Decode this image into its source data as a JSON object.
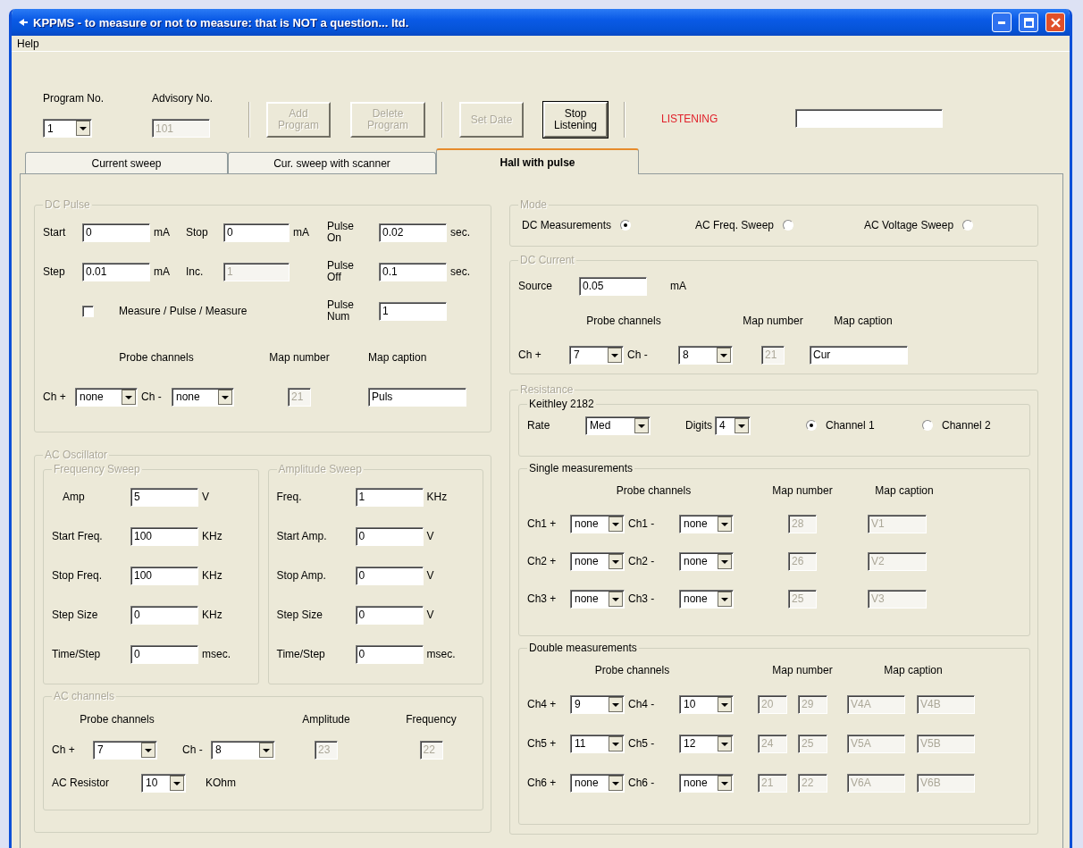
{
  "window": {
    "title": "KPPMS - to measure or not to measure: that is NOT a question...  ltd."
  },
  "menu": [
    {
      "label": "Help"
    }
  ],
  "toolbar": {
    "program_label": "Program No.",
    "program_value": "1",
    "advisory_label": "Advisory No.",
    "advisory_value": "101",
    "advisory_disabled": true,
    "buttons": [
      {
        "label": "Add Program",
        "disabled": true
      },
      {
        "label": "Delete Program",
        "disabled": true
      },
      {
        "label": "Set Date",
        "disabled": true
      },
      {
        "label": "Stop Listening",
        "disabled": false
      }
    ],
    "status": "LISTENING"
  },
  "tabs": [
    {
      "label": "Current sweep",
      "selected": false
    },
    {
      "label": "Cur. sweep with scanner",
      "selected": false
    },
    {
      "label": "Hall with pulse",
      "selected": true
    }
  ],
  "dc_pulse": {
    "title": "DC Pulse",
    "disabled": true,
    "items": [
      {
        "kind": "label",
        "text": "Start"
      },
      {
        "kind": "input",
        "value": "0",
        "disabled": false
      },
      {
        "kind": "label",
        "text": "mA"
      },
      {
        "kind": "label",
        "text": "Stop"
      },
      {
        "kind": "input",
        "value": "0",
        "disabled": false
      },
      {
        "kind": "label",
        "text": "mA"
      },
      {
        "kind": "label",
        "text": "Pulse On"
      },
      {
        "kind": "input",
        "value": "0.02",
        "disabled": false
      },
      {
        "kind": "label",
        "text": "sec."
      },
      {
        "kind": "label",
        "text": "Step"
      },
      {
        "kind": "input",
        "value": "0.01",
        "disabled": false
      },
      {
        "kind": "label",
        "text": "mA"
      },
      {
        "kind": "label",
        "text": "Inc."
      },
      {
        "kind": "input",
        "value": "1",
        "disabled": true
      },
      {
        "kind": "label",
        "text": "Pulse Off"
      },
      {
        "kind": "input",
        "value": "0.1",
        "disabled": false
      },
      {
        "kind": "label",
        "text": "sec."
      },
      {
        "kind": "check",
        "label": "Measure / Pulse / Measure",
        "checked": false
      },
      {
        "kind": "label",
        "text": "Pulse Num"
      },
      {
        "kind": "input",
        "value": "1",
        "disabled": false
      },
      {
        "kind": "label",
        "text": "Probe channels"
      },
      {
        "kind": "label",
        "text": "Map number"
      },
      {
        "kind": "label",
        "text": "Map caption"
      },
      {
        "kind": "label",
        "text": "Ch +"
      },
      {
        "kind": "combo",
        "value": "none"
      },
      {
        "kind": "label",
        "text": "Ch -"
      },
      {
        "kind": "combo",
        "value": "none"
      },
      {
        "kind": "input",
        "value": "21",
        "disabled": true
      },
      {
        "kind": "input",
        "value": "Puls",
        "disabled": false
      }
    ]
  },
  "ac_oscillator": {
    "title": "AC Oscillator",
    "disabled": true,
    "frequency_sweep": {
      "title": "Frequency Sweep",
      "disabled": true,
      "items": [
        {
          "kind": "label",
          "text": "Amp"
        },
        {
          "kind": "input",
          "value": "5",
          "disabled": false
        },
        {
          "kind": "label",
          "text": "V"
        },
        {
          "kind": "label",
          "text": "Start Freq."
        },
        {
          "kind": "input",
          "value": "100",
          "disabled": false
        },
        {
          "kind": "label",
          "text": "KHz"
        },
        {
          "kind": "label",
          "text": "Stop Freq."
        },
        {
          "kind": "input",
          "value": "100",
          "disabled": false
        },
        {
          "kind": "label",
          "text": "KHz"
        },
        {
          "kind": "label",
          "text": "Step Size"
        },
        {
          "kind": "input",
          "value": "0",
          "disabled": false
        },
        {
          "kind": "label",
          "text": "KHz"
        },
        {
          "kind": "label",
          "text": "Time/Step"
        },
        {
          "kind": "input",
          "value": "0",
          "disabled": false
        },
        {
          "kind": "label",
          "text": "msec."
        }
      ]
    },
    "amplitude_sweep": {
      "title": "Amplitude Sweep",
      "disabled": true,
      "items": [
        {
          "kind": "label",
          "text": "Freq."
        },
        {
          "kind": "input",
          "value": "1",
          "disabled": false
        },
        {
          "kind": "label",
          "text": "KHz"
        },
        {
          "kind": "label",
          "text": "Start Amp."
        },
        {
          "kind": "input",
          "value": "0",
          "disabled": false
        },
        {
          "kind": "label",
          "text": "V"
        },
        {
          "kind": "label",
          "text": "Stop Amp."
        },
        {
          "kind": "input",
          "value": "0",
          "disabled": false
        },
        {
          "kind": "label",
          "text": "V"
        },
        {
          "kind": "label",
          "text": "Step Size"
        },
        {
          "kind": "input",
          "value": "0",
          "disabled": false
        },
        {
          "kind": "label",
          "text": "V"
        },
        {
          "kind": "label",
          "text": "Time/Step"
        },
        {
          "kind": "input",
          "value": "0",
          "disabled": false
        },
        {
          "kind": "label",
          "text": "msec."
        }
      ]
    },
    "ac_channels": {
      "title": "AC channels",
      "disabled": true,
      "items": [
        {
          "kind": "label",
          "text": "Probe channels"
        },
        {
          "kind": "label",
          "text": "Amplitude"
        },
        {
          "kind": "label",
          "text": "Frequency"
        },
        {
          "kind": "label",
          "text": "Ch +"
        },
        {
          "kind": "combo",
          "value": "7"
        },
        {
          "kind": "label",
          "text": "Ch -"
        },
        {
          "kind": "combo",
          "value": "8"
        },
        {
          "kind": "input",
          "value": "23",
          "disabled": true
        },
        {
          "kind": "input",
          "value": "22",
          "disabled": true
        },
        {
          "kind": "label",
          "text": "AC Resistor"
        },
        {
          "kind": "combo",
          "value": "10"
        },
        {
          "kind": "label",
          "text": "KOhm"
        }
      ]
    }
  },
  "mode": {
    "title": "Mode",
    "disabled": true,
    "items": [
      {
        "kind": "radio",
        "label": "DC Measurements",
        "selected": true
      },
      {
        "kind": "radio",
        "label": "AC Freq. Sweep",
        "selected": false
      },
      {
        "kind": "radio",
        "label": "AC Voltage Sweep",
        "selected": false
      }
    ]
  },
  "dc_current": {
    "title": "DC Current",
    "disabled": true,
    "items": [
      {
        "kind": "label",
        "text": "Source"
      },
      {
        "kind": "input",
        "value": "0.05",
        "disabled": false
      },
      {
        "kind": "label",
        "text": "mA"
      },
      {
        "kind": "label",
        "text": "Probe channels"
      },
      {
        "kind": "label",
        "text": "Map number"
      },
      {
        "kind": "label",
        "text": "Map caption"
      },
      {
        "kind": "label",
        "text": "Ch +"
      },
      {
        "kind": "combo",
        "value": "7"
      },
      {
        "kind": "label",
        "text": "Ch -"
      },
      {
        "kind": "combo",
        "value": "8"
      },
      {
        "kind": "input",
        "value": "21",
        "disabled": true
      },
      {
        "kind": "input",
        "value": "Cur",
        "disabled": false
      }
    ]
  },
  "resistance": {
    "title": "Resistance",
    "disabled": true,
    "keithley": {
      "title": "Keithley 2182",
      "disabled": false,
      "items": [
        {
          "kind": "label",
          "text": "Rate"
        },
        {
          "kind": "combo",
          "value": "Med"
        },
        {
          "kind": "label",
          "text": "Digits"
        },
        {
          "kind": "combo",
          "value": "4"
        },
        {
          "kind": "radio",
          "label": "Channel 1",
          "selected": true
        },
        {
          "kind": "radio",
          "label": "Channel 2",
          "selected": false
        }
      ]
    },
    "single": {
      "title": "Single measurements",
      "disabled": false,
      "items": [
        {
          "kind": "label",
          "text": "Probe channels"
        },
        {
          "kind": "label",
          "text": "Map number"
        },
        {
          "kind": "label",
          "text": "Map caption"
        },
        {
          "kind": "label",
          "text": "Ch1 +"
        },
        {
          "kind": "combo",
          "value": "none"
        },
        {
          "kind": "label",
          "text": "Ch1 -"
        },
        {
          "kind": "combo",
          "value": "none"
        },
        {
          "kind": "input",
          "value": "28",
          "disabled": true
        },
        {
          "kind": "input",
          "value": "V1",
          "disabled": true
        },
        {
          "kind": "label",
          "text": "Ch2 +"
        },
        {
          "kind": "combo",
          "value": "none"
        },
        {
          "kind": "label",
          "text": "Ch2 -"
        },
        {
          "kind": "combo",
          "value": "none"
        },
        {
          "kind": "input",
          "value": "26",
          "disabled": true
        },
        {
          "kind": "input",
          "value": "V2",
          "disabled": true
        },
        {
          "kind": "label",
          "text": "Ch3 +"
        },
        {
          "kind": "combo",
          "value": "none"
        },
        {
          "kind": "label",
          "text": "Ch3 -"
        },
        {
          "kind": "combo",
          "value": "none"
        },
        {
          "kind": "input",
          "value": "25",
          "disabled": true
        },
        {
          "kind": "input",
          "value": "V3",
          "disabled": true
        }
      ]
    },
    "double": {
      "title": "Double measurements",
      "disabled": false,
      "items": [
        {
          "kind": "label",
          "text": "Probe channels"
        },
        {
          "kind": "label",
          "text": "Map number"
        },
        {
          "kind": "label",
          "text": "Map caption"
        },
        {
          "kind": "label",
          "text": "Ch4 +"
        },
        {
          "kind": "combo",
          "value": "9"
        },
        {
          "kind": "label",
          "text": "Ch4 -"
        },
        {
          "kind": "combo",
          "value": "10"
        },
        {
          "kind": "input",
          "value": "20",
          "disabled": true
        },
        {
          "kind": "input",
          "value": "29",
          "disabled": true
        },
        {
          "kind": "input",
          "value": "V4A",
          "disabled": true
        },
        {
          "kind": "input",
          "value": "V4B",
          "disabled": true
        },
        {
          "kind": "label",
          "text": "Ch5 +"
        },
        {
          "kind": "combo",
          "value": "11"
        },
        {
          "kind": "label",
          "text": "Ch5 -"
        },
        {
          "kind": "combo",
          "value": "12"
        },
        {
          "kind": "input",
          "value": "24",
          "disabled": true
        },
        {
          "kind": "input",
          "value": "25",
          "disabled": true
        },
        {
          "kind": "input",
          "value": "V5A",
          "disabled": true
        },
        {
          "kind": "input",
          "value": "V5B",
          "disabled": true
        },
        {
          "kind": "label",
          "text": "Ch6 +"
        },
        {
          "kind": "combo",
          "value": "none"
        },
        {
          "kind": "label",
          "text": "Ch6 -"
        },
        {
          "kind": "combo",
          "value": "none"
        },
        {
          "kind": "input",
          "value": "21",
          "disabled": true
        },
        {
          "kind": "input",
          "value": "22",
          "disabled": true
        },
        {
          "kind": "input",
          "value": "V6A",
          "disabled": true
        },
        {
          "kind": "input",
          "value": "V6B",
          "disabled": true
        }
      ]
    }
  }
}
